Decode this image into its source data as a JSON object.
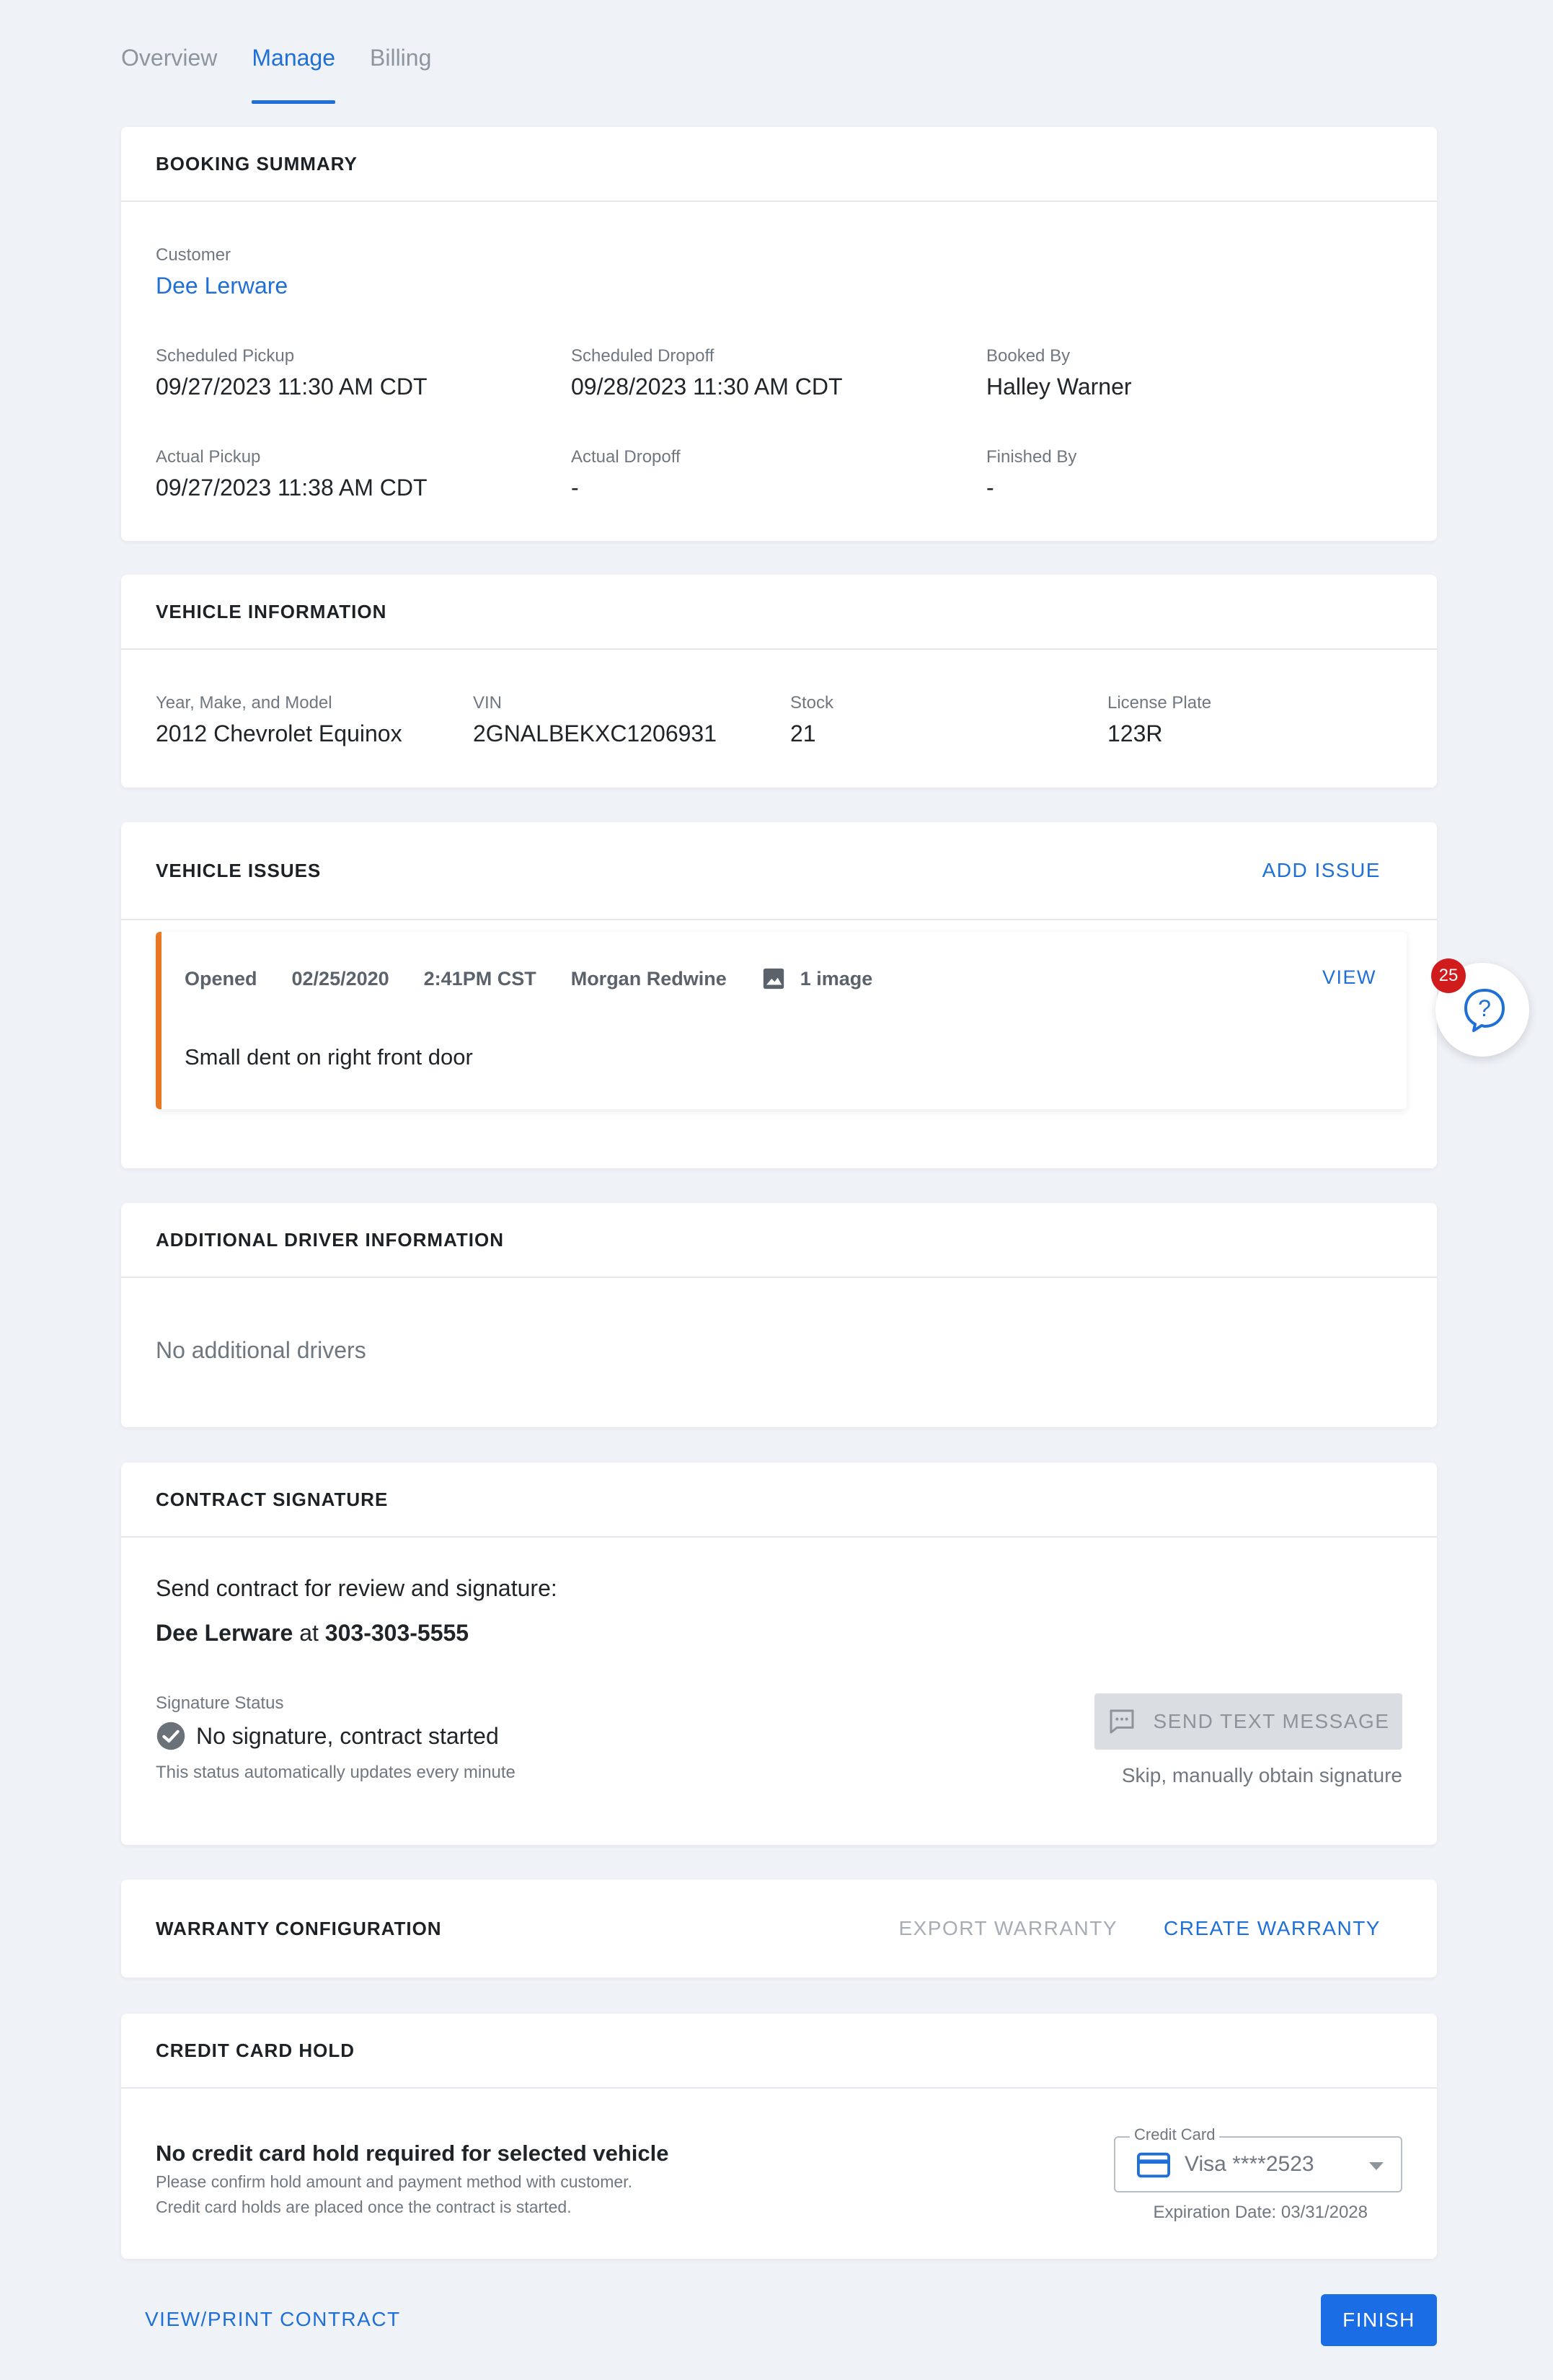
{
  "tabs": [
    {
      "label": "Overview"
    },
    {
      "label": "Manage"
    },
    {
      "label": "Billing"
    }
  ],
  "booking_summary": {
    "title": "BOOKING SUMMARY",
    "customer_label": "Customer",
    "customer_name": "Dee Lerware",
    "scheduled_pickup_label": "Scheduled Pickup",
    "scheduled_pickup": "09/27/2023 11:30 AM CDT",
    "scheduled_dropoff_label": "Scheduled Dropoff",
    "scheduled_dropoff": "09/28/2023 11:30 AM CDT",
    "booked_by_label": "Booked By",
    "booked_by": "Halley Warner",
    "actual_pickup_label": "Actual Pickup",
    "actual_pickup": "09/27/2023 11:38 AM CDT",
    "actual_dropoff_label": "Actual Dropoff",
    "actual_dropoff": "-",
    "finished_by_label": "Finished By",
    "finished_by": "-"
  },
  "vehicle_information": {
    "title": "VEHICLE INFORMATION",
    "ymm_label": "Year, Make, and Model",
    "ymm": "2012 Chevrolet Equinox",
    "vin_label": "VIN",
    "vin": "2GNALBEKXC1206931",
    "stock_label": "Stock",
    "stock": "21",
    "plate_label": "License Plate",
    "plate": "123R"
  },
  "vehicle_issues": {
    "title": "VEHICLE ISSUES",
    "add_label": "ADD ISSUE",
    "issue": {
      "status": "Opened",
      "date": "02/25/2020",
      "time": "2:41PM CST",
      "author": "Morgan Redwine",
      "images": "1 image",
      "view_label": "VIEW",
      "description": "Small dent on right front door"
    }
  },
  "additional_drivers": {
    "title": "ADDITIONAL DRIVER INFORMATION",
    "empty_text": "No additional drivers"
  },
  "contract_signature": {
    "title": "CONTRACT SIGNATURE",
    "send_text": "Send contract for review and signature:",
    "recipient_name": "Dee Lerware",
    "at_text": "at",
    "recipient_phone": "303-303-5555",
    "status_label": "Signature Status",
    "status_value": "No signature, contract started",
    "status_note": "This status automatically updates every minute",
    "send_button": "SEND TEXT MESSAGE",
    "skip_text": "Skip, manually obtain signature"
  },
  "warranty": {
    "title": "WARRANTY CONFIGURATION",
    "export_label": "EXPORT WARRANTY",
    "create_label": "CREATE WARRANTY"
  },
  "credit_card_hold": {
    "title": "CREDIT CARD HOLD",
    "heading": "No credit card hold required for selected vehicle",
    "note_1": "Please confirm hold amount and payment method with customer.",
    "note_2": "Credit card holds are placed once the contract is started.",
    "card_label": "Credit Card",
    "card_value": "Visa ****2523",
    "expiration": "Expiration Date: 03/31/2028"
  },
  "footer": {
    "print_label": "VIEW/PRINT CONTRACT",
    "finish_label": "FINISH"
  },
  "help": {
    "badge_count": "25"
  },
  "colors": {
    "accent": "#1f6fd8",
    "issue_marker": "#e87722",
    "badge": "#d01c1c",
    "background": "#eff2f6"
  }
}
